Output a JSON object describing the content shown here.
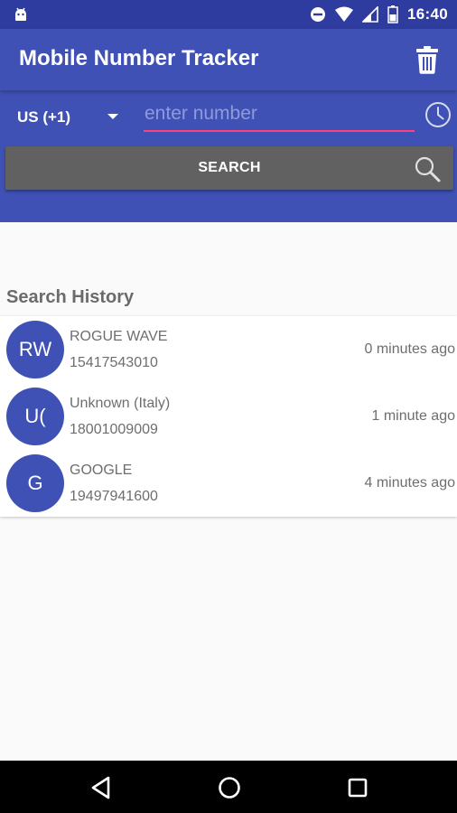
{
  "status_bar": {
    "time": "16:40",
    "icons": [
      "android-icon",
      "do-not-disturb-icon",
      "wifi-icon",
      "signal-icon",
      "battery-icon"
    ]
  },
  "app_bar": {
    "title": "Mobile Number Tracker",
    "action_icon": "trash-icon"
  },
  "search_form": {
    "country": "US (+1)",
    "number_placeholder": "enter number",
    "number_value": "",
    "search_label": "SEARCH",
    "history_icon": "clock-icon"
  },
  "history": {
    "title": "Search History",
    "items": [
      {
        "initials": "RW",
        "name": "ROGUE WAVE",
        "number": "15417543010",
        "time": "0 minutes ago"
      },
      {
        "initials": "U(",
        "name": "Unknown (Italy)",
        "number": "18001009009",
        "time": "1 minute ago"
      },
      {
        "initials": "G",
        "name": "GOOGLE",
        "number": "19497941600",
        "time": "4 minutes ago"
      }
    ]
  },
  "colors": {
    "primary": "#3f51b5",
    "primary_dark": "#2f3c9f",
    "accent": "#ff4081",
    "button": "#616161"
  }
}
